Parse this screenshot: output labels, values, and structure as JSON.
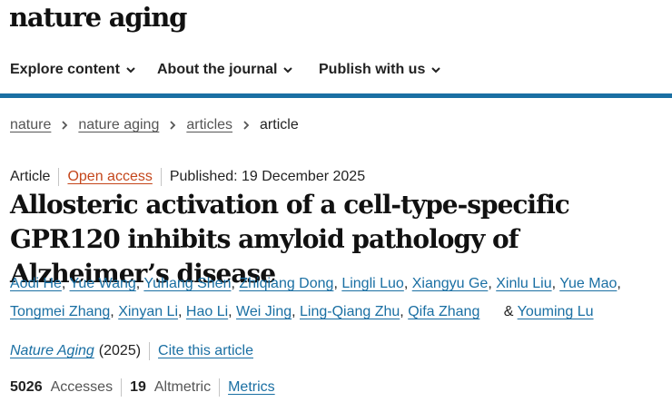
{
  "site": {
    "logo": "nature aging"
  },
  "nav": {
    "items": [
      {
        "label": "Explore content",
        "icon": "chevron-down-icon"
      },
      {
        "label": "About the journal",
        "icon": "chevron-down-icon"
      },
      {
        "label": "Publish with us",
        "icon": "chevron-down-icon"
      }
    ],
    "accent_color": "#1a6fa3"
  },
  "breadcrumb": {
    "items": [
      "nature",
      "nature aging",
      "articles"
    ],
    "current": "article",
    "separator_icon": "chevron-right-icon"
  },
  "article": {
    "type": "Article",
    "access": "Open access",
    "published": "Published: 19 December 2025",
    "title": "Allosteric activation of a cell-type-specific GPR120 inhibits amyloid pathology of Alzheimer’s disease",
    "authors": [
      "Aodi He",
      "Yue Wang",
      "Yuhang Shen",
      "Zhiqiang Dong",
      "Lingli Luo",
      "Xiangyu Ge",
      "Xinlu Liu",
      "Yue Mao",
      "Tongmei Zhang",
      "Xinyan Li",
      "Hao Li",
      "Wei Jing",
      "Ling-Qiang Zhu",
      "Qifa Zhang"
    ],
    "last_author_prefix": "&",
    "last_author": "Youming Lu",
    "journal": "Nature Aging",
    "year": "(2025)",
    "cite_label": "Cite this article",
    "accesses_count": "5026",
    "accesses_label": "Accesses",
    "altmetric_count": "19",
    "altmetric_label": "Altmetric",
    "metrics_label": "Metrics",
    "open_access_color": "#c4461b",
    "link_color": "#1a6fa3"
  }
}
